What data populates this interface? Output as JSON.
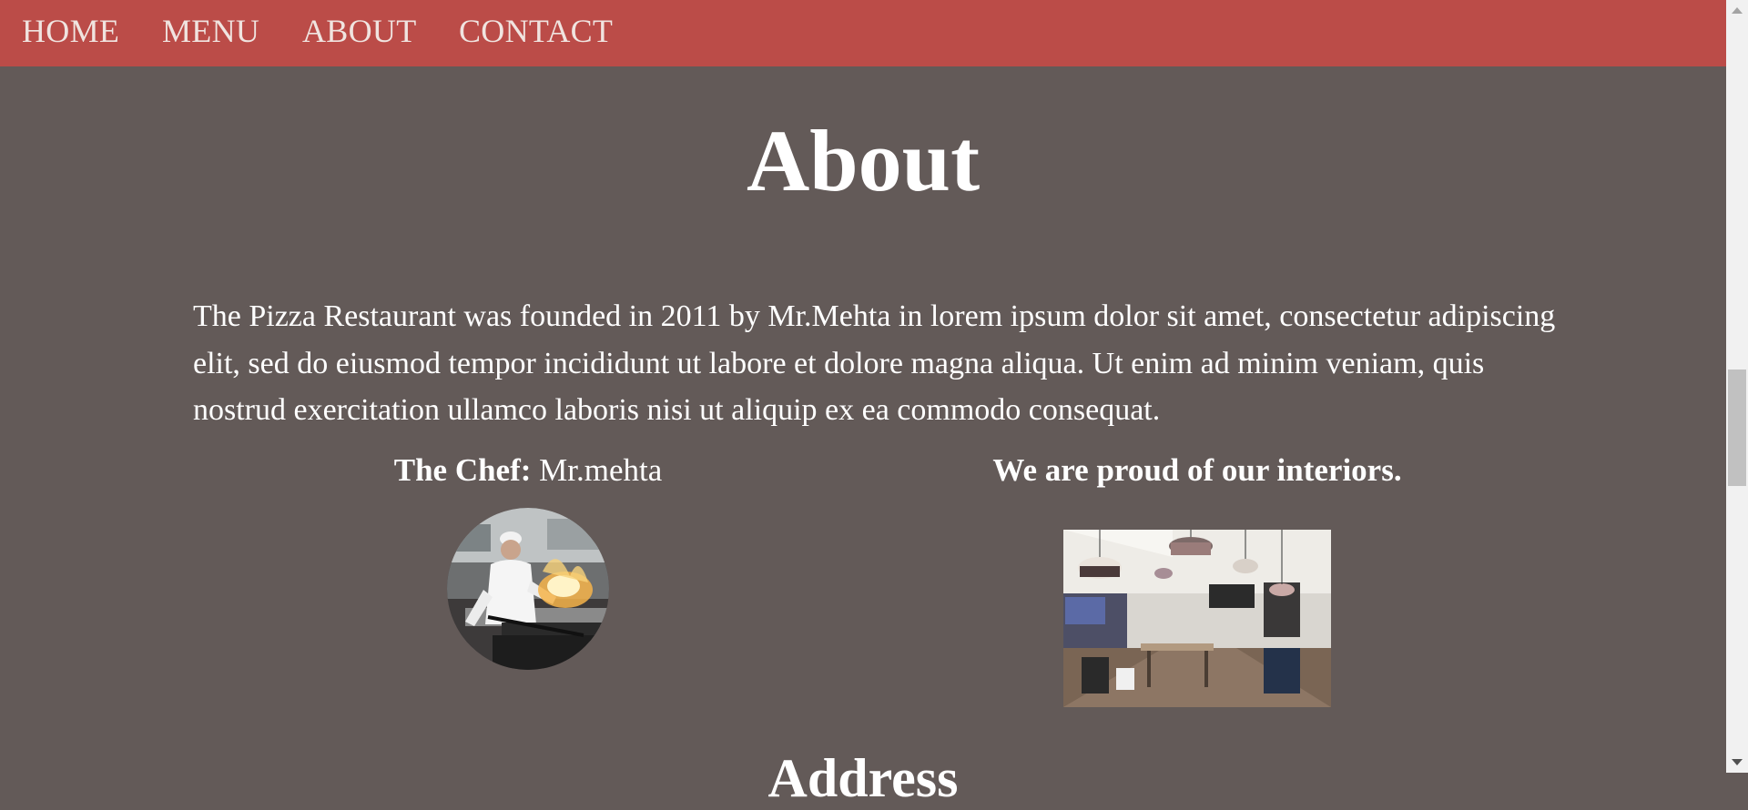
{
  "nav": {
    "items": [
      {
        "label": "HOME"
      },
      {
        "label": "MENU"
      },
      {
        "label": "ABOUT"
      },
      {
        "label": "CONTACT"
      }
    ]
  },
  "about": {
    "title": "About",
    "intro": "The Pizza Restaurant was founded in 2011 by Mr.Mehta in lorem ipsum dolor sit amet, consectetur adipiscing elit, sed do eiusmod tempor incididunt ut labore et dolore magna aliqua. Ut enim ad minim veniam, quis nostrud exercitation ullamco laboris nisi ut aliquip ex ea commodo consequat.",
    "chef_label": "The Chef:",
    "chef_name": "Mr.mehta",
    "interior_heading": "We are proud of our interiors."
  },
  "address": {
    "heading": "Address"
  },
  "colors": {
    "nav_background": "#bb4c48",
    "page_background": "#635a58",
    "text": "#ffffff"
  }
}
